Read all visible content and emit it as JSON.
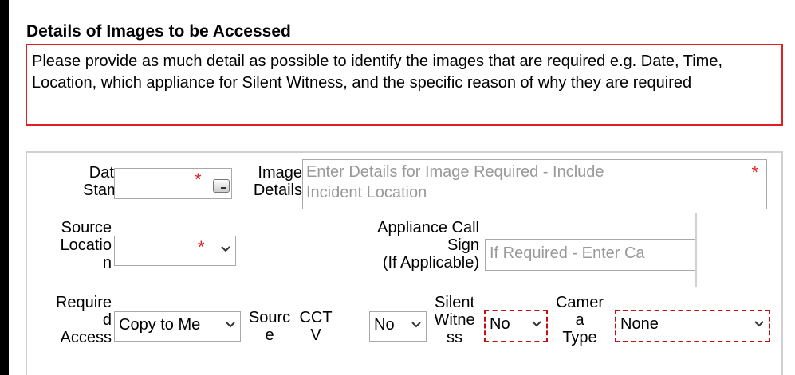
{
  "section": {
    "title": "Details of Images to be Accessed",
    "info": "Please provide as much detail as possible to identify the images that are required e.g. Date, Time, Location, which appliance for Silent Witness, and the specific reason of why they are required"
  },
  "form": {
    "date_stamp": {
      "label_line1": "Date",
      "label_line2": "Stamp",
      "value": ""
    },
    "image_details": {
      "label_line1": "Image",
      "label_line2": "Details",
      "placeholder_line1": "Enter Details for Image Required - Include",
      "placeholder_line2": "Incident Location"
    },
    "source_location": {
      "label_line1": "Source",
      "label_line2": "Locatio",
      "label_line3": "n",
      "value": ""
    },
    "appliance_call_sign": {
      "label_line1": "Appliance Call",
      "label_line2": "Sign",
      "label_line3": "(If Applicable)",
      "placeholder": "If Required - Enter Ca"
    },
    "required_access": {
      "label_line1": "Require",
      "label_line2": "d",
      "label_line3": "Access",
      "value": "Copy to Me"
    },
    "source_cctv": {
      "label1_line1": "Sourc",
      "label1_line2": "e",
      "label2_line1": "CCT",
      "label2_line2": "V",
      "value": "No"
    },
    "silent_witness": {
      "label_line1": "Silent",
      "label_line2": "Witne",
      "label_line3": "ss",
      "value": "No"
    },
    "camera_type": {
      "label_line1": "Camer",
      "label_line2": "a",
      "label_line3": "Type",
      "value": "None"
    }
  },
  "required_marker": "*",
  "colors": {
    "required": "#e02020",
    "invalid_border": "#c01010",
    "placeholder": "#999999"
  }
}
